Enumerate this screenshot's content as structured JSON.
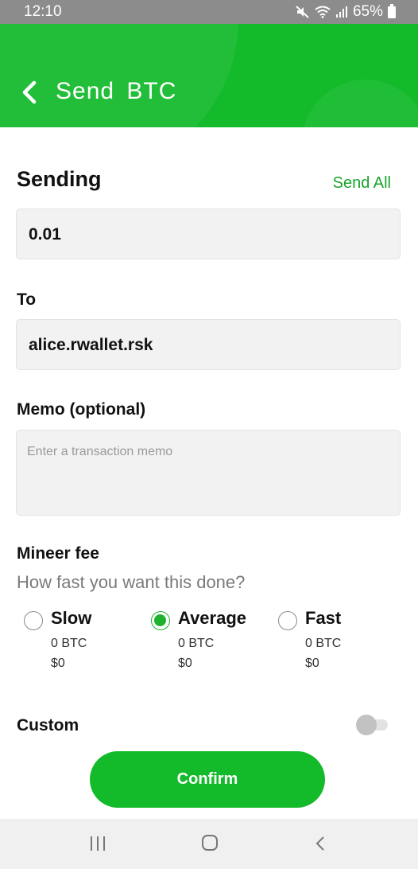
{
  "status_bar": {
    "time": "12:10",
    "battery": "65%"
  },
  "header": {
    "title": "Send  BTC"
  },
  "sending": {
    "label": "Sending",
    "send_all": "Send All",
    "amount": "0.01"
  },
  "to": {
    "label": "To",
    "value": "alice.rwallet.rsk"
  },
  "memo": {
    "label": "Memo (optional)",
    "placeholder": "Enter a transaction memo"
  },
  "fee": {
    "label": "Mineer fee",
    "subtitle": "How fast you want this done?",
    "selected": "Average",
    "options": [
      {
        "name": "Slow",
        "btc": "0 BTC",
        "usd": "$0"
      },
      {
        "name": "Average",
        "btc": "0 BTC",
        "usd": "$0"
      },
      {
        "name": "Fast",
        "btc": "0 BTC",
        "usd": "$0"
      }
    ]
  },
  "custom": {
    "label": "Custom",
    "enabled": false
  },
  "confirm_label": "Confirm",
  "colors": {
    "brand_green": "#13ba2a",
    "link_green": "#17a42b"
  }
}
